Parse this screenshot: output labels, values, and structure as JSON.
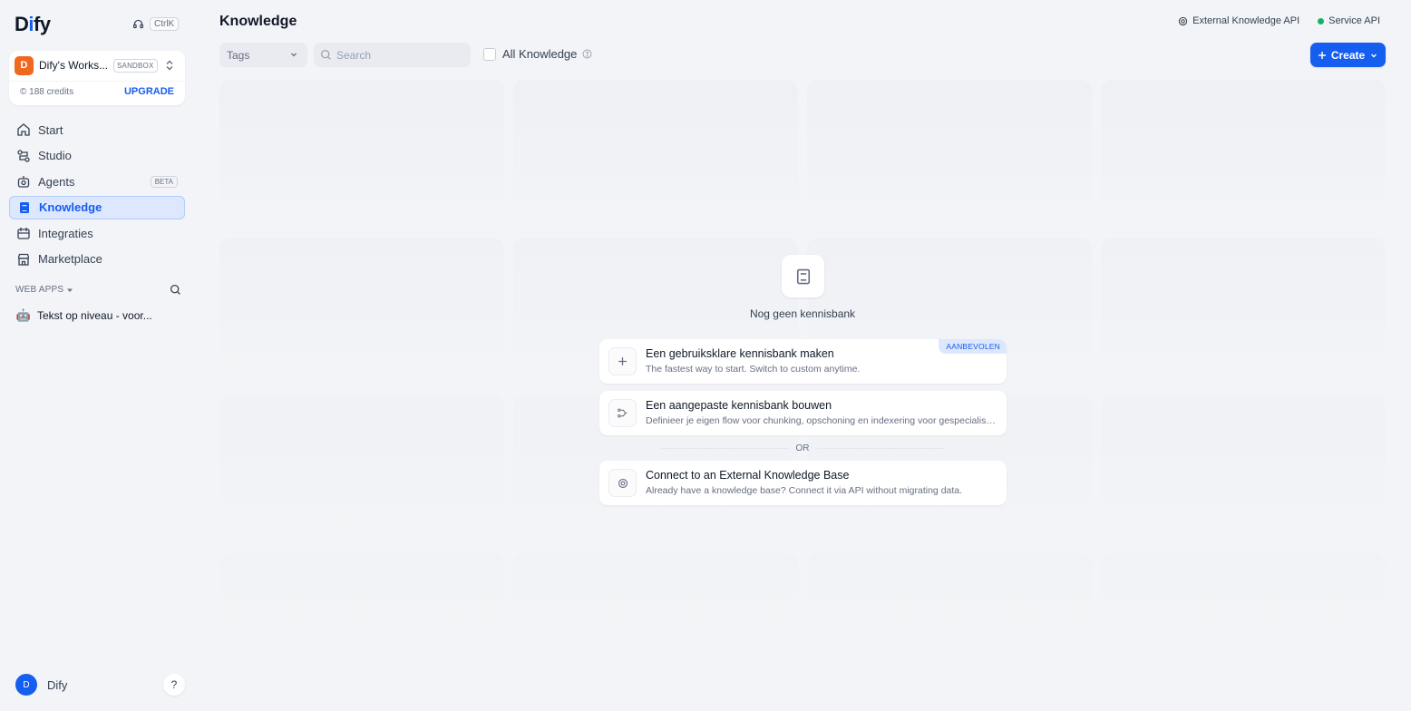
{
  "sidebar": {
    "logo": {
      "prefix": "D",
      "accent": "i",
      "suffix": "fy"
    },
    "shortcut": "CtrlK",
    "workspace": {
      "avatar_letter": "D",
      "name": "Dify's Works...",
      "plan_badge": "SANDBOX",
      "credits": "188 credits",
      "upgrade": "UPGRADE"
    },
    "nav": [
      {
        "label": "Start",
        "icon": "home-icon"
      },
      {
        "label": "Studio",
        "icon": "studio-icon"
      },
      {
        "label": "Agents",
        "icon": "agent-icon",
        "badge": "BETA"
      },
      {
        "label": "Knowledge",
        "icon": "book-icon",
        "active": true
      },
      {
        "label": "Integraties",
        "icon": "integrations-icon"
      },
      {
        "label": "Marketplace",
        "icon": "store-icon"
      }
    ],
    "web_apps_header": "WEB APPS",
    "web_apps": [
      {
        "emoji": "🤖",
        "label": "Tekst op niveau - voor..."
      }
    ],
    "user": {
      "avatar_letter": "D",
      "name": "Dify"
    },
    "help": "?"
  },
  "header": {
    "title": "Knowledge",
    "links": {
      "external_api": "External Knowledge API",
      "service_api": "Service API"
    }
  },
  "toolbar": {
    "tags_label": "Tags",
    "search_placeholder": "Search",
    "all_knowledge_label": "All Knowledge",
    "create_label": "Create"
  },
  "empty_state": {
    "message": "Nog geen kennisbank",
    "options": [
      {
        "title": "Een gebruiksklare kennisbank maken",
        "description": "The fastest way to start. Switch to custom anytime.",
        "badge": "AANBEVOLEN"
      },
      {
        "title": "Een aangepaste kennisbank bouwen",
        "description": "Definieer je eigen flow voor chunking, opschoning en indexering voor gespecialiseerde behoeften."
      },
      {
        "title": "Connect to an External Knowledge Base",
        "description": "Already have a knowledge base? Connect it via API without migrating data."
      }
    ],
    "or_label": "OR"
  },
  "colors": {
    "accent": "#155eef",
    "workspace_avatar": "#ef6820",
    "status_green": "#17b26a"
  }
}
